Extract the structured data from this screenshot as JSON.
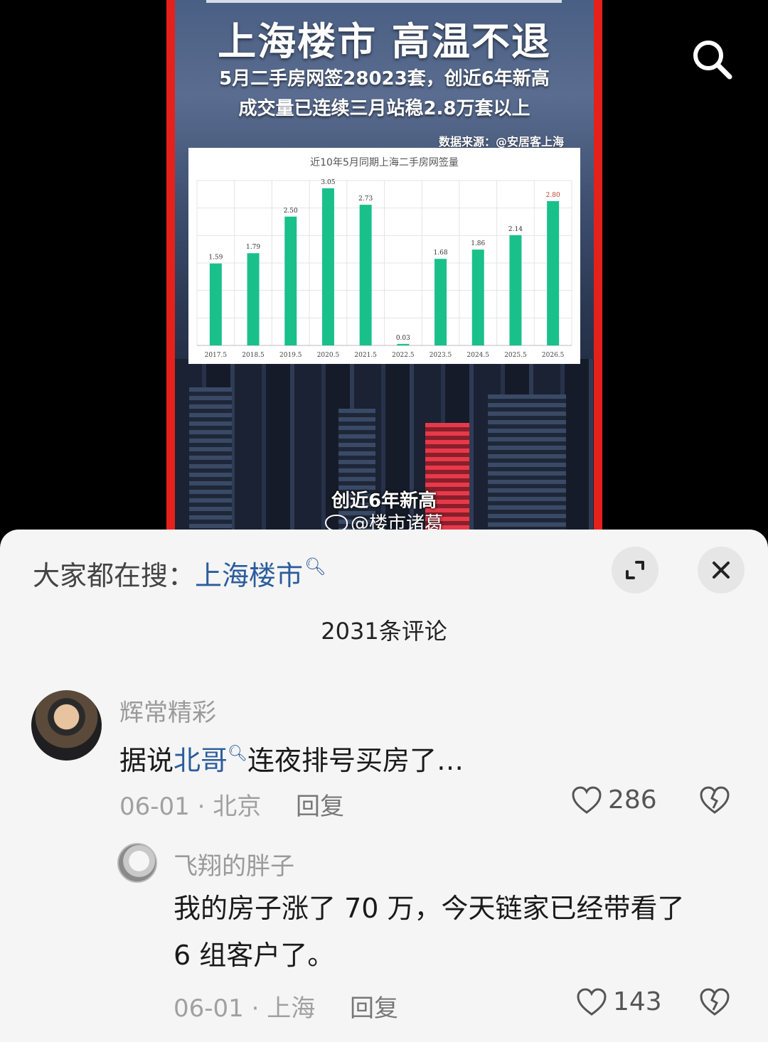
{
  "poster": {
    "title": "上海楼市  高温不退",
    "subtitle_1": "5月二手房网签28023套，创近6年新高",
    "subtitle_2": "成交量已连续三月站稳2.8万套以上",
    "source": "数据来源：@安居客上海",
    "caption": "创近6年新高",
    "handle": "@楼市诸葛"
  },
  "chart_data": {
    "type": "bar",
    "title": "近10年5月同期上海二手房网签量",
    "categories": [
      "2017.5",
      "2018.5",
      "2019.5",
      "2020.5",
      "2021.5",
      "2022.5",
      "2023.5",
      "2024.5",
      "2025.5",
      "2026.5"
    ],
    "values": [
      1.59,
      1.79,
      2.5,
      3.05,
      2.73,
      0.03,
      1.68,
      1.86,
      2.14,
      2.8
    ],
    "labels": [
      "1.59",
      "1.79",
      "2.50",
      "3.05",
      "2.73",
      "0.03",
      "1.68",
      "1.86",
      "2.14",
      "2.80"
    ],
    "ylim": [
      0,
      3.2
    ],
    "grid": true,
    "bar_color": "#19c08a",
    "highlight_label_color": "#c0392b",
    "highlight_index": 9
  },
  "sheet": {
    "hot_search_prefix": "大家都在搜：",
    "hot_search_keyword": "上海楼市",
    "comment_count": "2031条评论"
  },
  "comments": [
    {
      "user": "辉常精彩",
      "text_before": "据说",
      "text_link": "北哥",
      "text_after": "连夜排号买房了…",
      "date": "06-01",
      "location": "北京",
      "reply_label": "回复",
      "likes": "286"
    },
    {
      "user": "飞翔的胖子",
      "text_line1": "我的房子涨了 70 万，今天链家已经带看了",
      "text_line2": "6 组客户了。",
      "date": "06-01",
      "location": "上海",
      "reply_label": "回复",
      "likes": "143"
    }
  ],
  "colors": {
    "accent_link": "#2b5c9c",
    "poster_border": "#e4221b"
  }
}
